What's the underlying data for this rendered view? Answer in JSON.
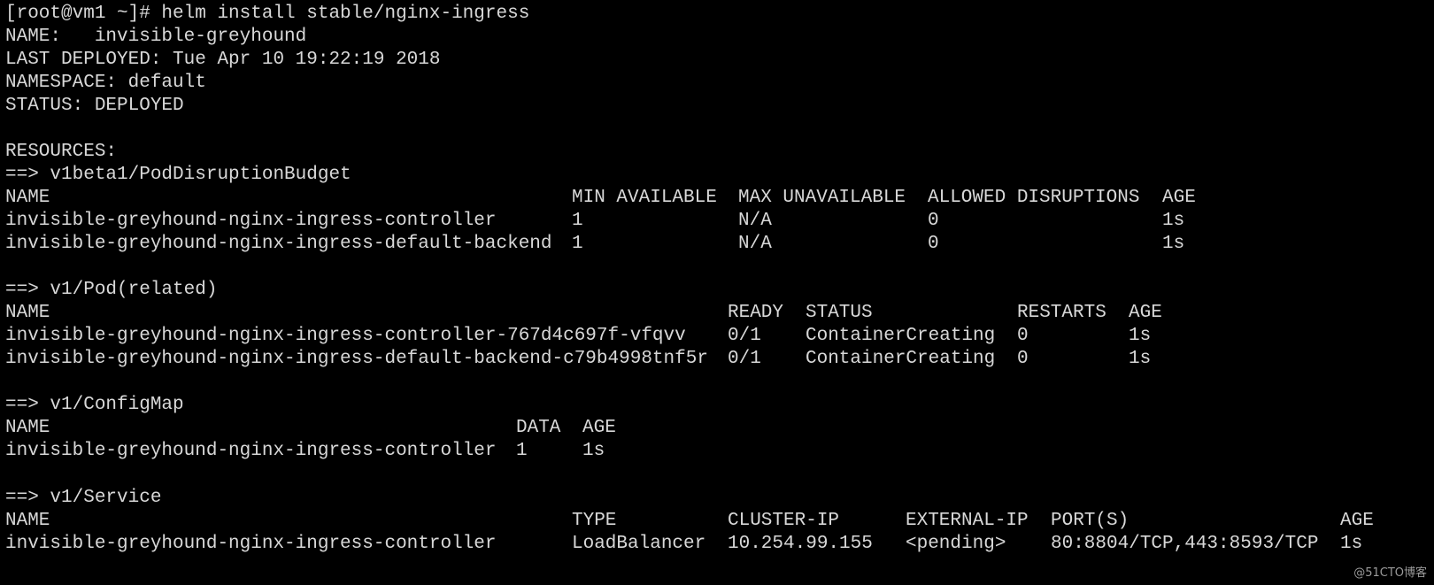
{
  "terminal": {
    "bg": "#000000",
    "fg": "#d8d8d8",
    "prompt_command": "[root@vm1 ~]# helm install stable/nginx-ingress",
    "release": {
      "name_line": "NAME:   invisible-greyhound",
      "last_deployed_line": "LAST DEPLOYED: Tue Apr 10 19:22:19 2018",
      "namespace_line": "NAMESPACE: default",
      "status_line": "STATUS: DEPLOYED"
    },
    "resources_heading": "RESOURCES:",
    "pdb": {
      "header": "==> v1beta1/PodDisruptionBudget",
      "columns": [
        "NAME",
        "MIN AVAILABLE",
        "MAX UNAVAILABLE",
        "ALLOWED DISRUPTIONS",
        "AGE"
      ],
      "rows": [
        [
          "invisible-greyhound-nginx-ingress-controller",
          "1",
          "N/A",
          "0",
          "1s"
        ],
        [
          "invisible-greyhound-nginx-ingress-default-backend",
          "1",
          "N/A",
          "0",
          "1s"
        ]
      ]
    },
    "pod": {
      "header": "==> v1/Pod(related)",
      "columns": [
        "NAME",
        "READY",
        "STATUS",
        "RESTARTS",
        "AGE"
      ],
      "rows": [
        [
          "invisible-greyhound-nginx-ingress-controller-767d4c697f-vfqvv",
          "0/1",
          "ContainerCreating",
          "0",
          "1s"
        ],
        [
          "invisible-greyhound-nginx-ingress-default-backend-c79b4998tnf5r",
          "0/1",
          "ContainerCreating",
          "0",
          "1s"
        ]
      ]
    },
    "configmap": {
      "header": "==> v1/ConfigMap",
      "columns": [
        "NAME",
        "DATA",
        "AGE"
      ],
      "rows": [
        [
          "invisible-greyhound-nginx-ingress-controller",
          "1",
          "1s"
        ]
      ]
    },
    "service": {
      "header": "==> v1/Service",
      "columns": [
        "NAME",
        "TYPE",
        "CLUSTER-IP",
        "EXTERNAL-IP",
        "PORT(S)",
        "AGE"
      ],
      "rows": [
        [
          "invisible-greyhound-nginx-ingress-controller",
          "LoadBalancer",
          "10.254.99.155",
          "<pending>",
          "80:8804/TCP,443:8593/TCP",
          "1s"
        ]
      ]
    },
    "watermark": "@51CTO博客"
  }
}
